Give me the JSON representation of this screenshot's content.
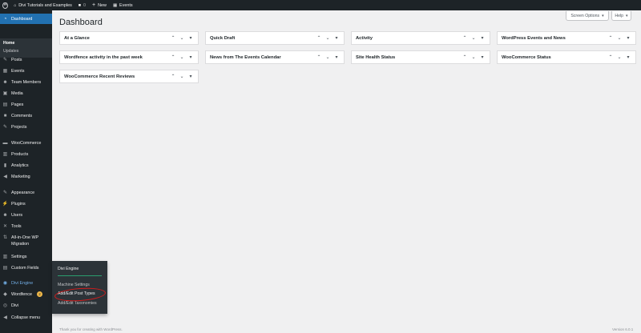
{
  "admin_bar": {
    "site_name": "Divi Tutorials and Examples",
    "comments_count": "0",
    "new_label": "New",
    "events_label": "Events"
  },
  "sidebar": {
    "dashboard": "Dashboard",
    "home": "Home",
    "updates": "Updates",
    "posts": "Posts",
    "events": "Events",
    "team_members": "Team Members",
    "media": "Media",
    "pages": "Pages",
    "comments": "Comments",
    "projects": "Projects",
    "woocommerce": "WooCommerce",
    "products": "Products",
    "analytics": "Analytics",
    "marketing": "Marketing",
    "appearance": "Appearance",
    "plugins": "Plugins",
    "users": "Users",
    "tools": "Tools",
    "all_in_one_line1": "All-in-One WP",
    "all_in_one_line2": "Migration",
    "settings": "Settings",
    "custom_fields": "Custom Fields",
    "divi_engine": "Divi Engine",
    "wordfence": "Wordfence",
    "wordfence_badge": "2",
    "divi": "Divi",
    "collapse": "Collapse menu"
  },
  "flyout": {
    "title": "Divi Engine",
    "items": [
      "Machine Settings",
      "Add/Edit Post Types",
      "Add/Edit Taxonomies"
    ]
  },
  "main": {
    "title": "Dashboard",
    "screen_options": "Screen Options",
    "help": "Help",
    "widgets": [
      "At a Glance",
      "Quick Draft",
      "Activity",
      "WordPress Events and News",
      "Wordfence activity in the past week",
      "News from The Events Calendar",
      "Site Health Status",
      "WooCommerce Status",
      "WooCommerce Recent Reviews"
    ]
  },
  "footer": {
    "thanks": "Thank you for creating with WordPress.",
    "version": "Version 6.0.1"
  },
  "colors": {
    "admin_bar": "#1d2327",
    "accent": "#2271b1",
    "circle": "#d21d1d"
  }
}
